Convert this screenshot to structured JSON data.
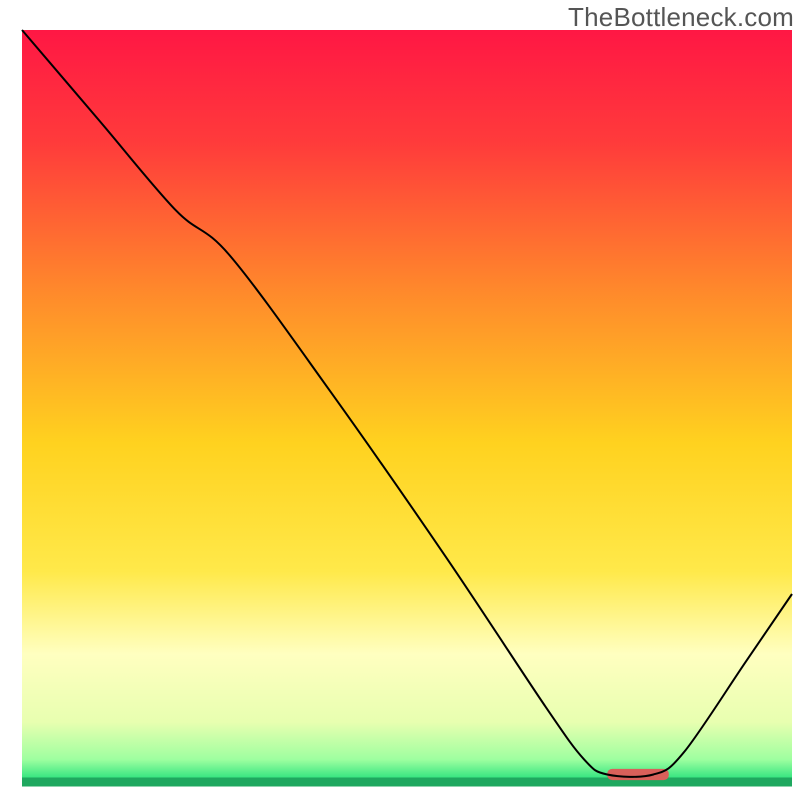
{
  "watermark": "TheBottleneck.com",
  "chart_data": {
    "type": "line",
    "title": "",
    "xlabel": "",
    "ylabel": "",
    "xlim": [
      0,
      100
    ],
    "ylim": [
      0,
      100
    ],
    "grid": false,
    "background_gradient": {
      "type": "vertical",
      "stops": [
        {
          "offset": 0.0,
          "color": "#ff1744"
        },
        {
          "offset": 0.15,
          "color": "#ff3b3b"
        },
        {
          "offset": 0.35,
          "color": "#ff8a2b"
        },
        {
          "offset": 0.55,
          "color": "#ffd21f"
        },
        {
          "offset": 0.72,
          "color": "#ffe94a"
        },
        {
          "offset": 0.83,
          "color": "#ffffc0"
        },
        {
          "offset": 0.92,
          "color": "#e8ffb0"
        },
        {
          "offset": 0.97,
          "color": "#9effa0"
        },
        {
          "offset": 1.0,
          "color": "#1fe07a"
        }
      ]
    },
    "series": [
      {
        "name": "bottleneck-curve",
        "color": "#000000",
        "width": 2,
        "points": [
          {
            "x": 0,
            "y": 100
          },
          {
            "x": 10,
            "y": 88
          },
          {
            "x": 20,
            "y": 76
          },
          {
            "x": 27,
            "y": 70
          },
          {
            "x": 40,
            "y": 52
          },
          {
            "x": 55,
            "y": 30
          },
          {
            "x": 68,
            "y": 10
          },
          {
            "x": 73,
            "y": 3
          },
          {
            "x": 76,
            "y": 1
          },
          {
            "x": 82,
            "y": 1
          },
          {
            "x": 86,
            "y": 4
          },
          {
            "x": 94,
            "y": 16
          },
          {
            "x": 100,
            "y": 25
          }
        ]
      }
    ],
    "marker": {
      "name": "optimal-range",
      "color": "#d9605a",
      "x_start": 76,
      "x_end": 84,
      "y": 1,
      "thickness_pct": 1.5
    },
    "baseline": {
      "color": "#1fa85f",
      "y": 0,
      "thickness_pct": 0.6
    }
  }
}
